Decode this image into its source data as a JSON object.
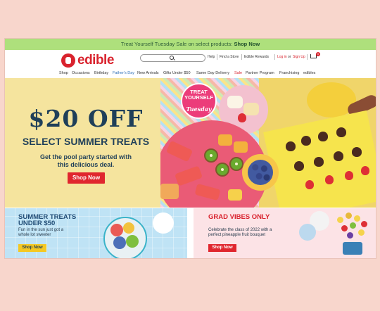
{
  "promo_bar": {
    "text": "Treat Yourself Tuesday Sale on select products:",
    "link": "Shop Now",
    "color": "#aee07c"
  },
  "brand": {
    "name": "edible",
    "color": "#d9232e"
  },
  "header_links": {
    "help": "Help",
    "find_store": "Find a Store",
    "rewards": "Edible Rewards",
    "login": "Log in",
    "or": "or",
    "signup": "Sign Up",
    "cart_count": "0"
  },
  "nav": [
    "Shop",
    "Occasions",
    "Birthday",
    "Father's Day",
    "New Arrivals",
    "Gifts Under $50",
    "Same Day Delivery",
    "Sale",
    "Partner Program",
    "Franchising",
    "edibles"
  ],
  "hero": {
    "headline": "$20 OFF",
    "subhead": "SELECT SUMMER TREATS",
    "body": "Get the pool party started with this delicious deal.",
    "cta": "Shop Now",
    "badge_top": "TREAT YOURSELF",
    "badge_script": "Tuesday"
  },
  "promo_left": {
    "title": "SUMMER TREATS UNDER $50",
    "text": "Fun in the sun just got a whole lot sweeter",
    "cta": "Shop Now"
  },
  "promo_right": {
    "title": "GRAD VIBES ONLY",
    "text": "Celebrate the class of 2022 with a perfect pineapple fruit bouquet",
    "cta": "Shop Now"
  }
}
